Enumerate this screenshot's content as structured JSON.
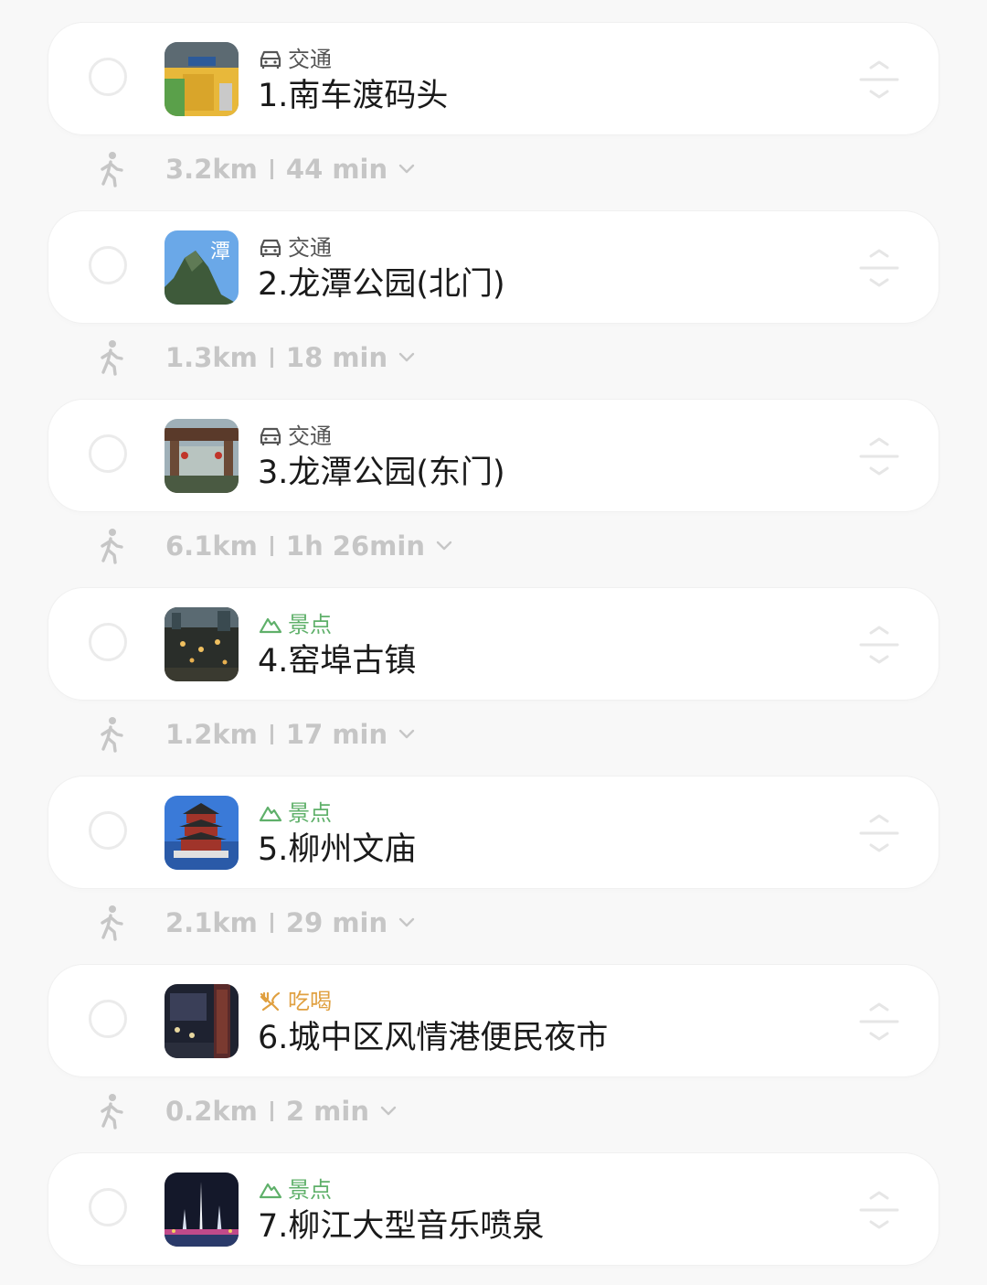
{
  "itinerary": {
    "stops": [
      {
        "category": "交通",
        "category_type": "transport",
        "category_icon": "car-icon",
        "title": "1.南车渡码头"
      },
      {
        "category": "交通",
        "category_type": "transport",
        "category_icon": "car-icon",
        "title": "2.龙潭公园(北门)"
      },
      {
        "category": "交通",
        "category_type": "transport",
        "category_icon": "car-icon",
        "title": "3.龙潭公园(东门)"
      },
      {
        "category": "景点",
        "category_type": "scenic",
        "category_icon": "mountain-icon",
        "title": "4.窑埠古镇"
      },
      {
        "category": "景点",
        "category_type": "scenic",
        "category_icon": "mountain-icon",
        "title": "5.柳州文庙"
      },
      {
        "category": "吃喝",
        "category_type": "food",
        "category_icon": "fork-knife-icon",
        "title": "6.城中区风情港便民夜市"
      },
      {
        "category": "景点",
        "category_type": "scenic",
        "category_icon": "mountain-icon",
        "title": "7.柳江大型音乐喷泉"
      }
    ],
    "legs": [
      {
        "distance": "3.2km",
        "duration": "44 min"
      },
      {
        "distance": "1.3km",
        "duration": "18 min"
      },
      {
        "distance": "6.1km",
        "duration": "1h 26min"
      },
      {
        "distance": "1.2km",
        "duration": "17 min"
      },
      {
        "distance": "2.1km",
        "duration": "29 min"
      },
      {
        "distance": "0.2km",
        "duration": "2 min"
      }
    ]
  },
  "colors": {
    "transport": "#555555",
    "scenic": "#5fb06a",
    "food": "#e0a040",
    "leg_text": "#c6c6c6"
  }
}
